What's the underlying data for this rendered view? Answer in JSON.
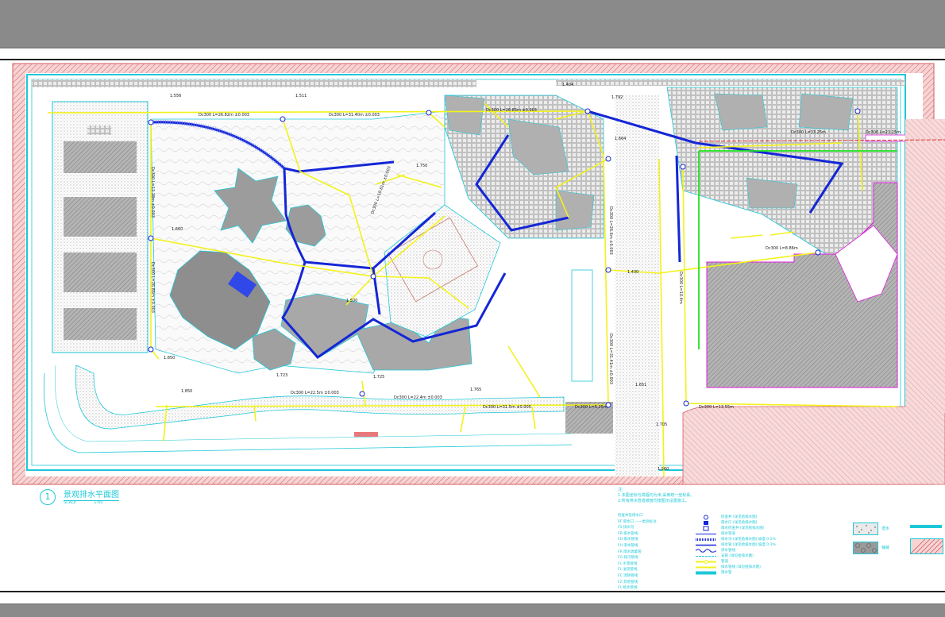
{
  "window": {
    "top_bar": "",
    "bottom_bar": ""
  },
  "plan": {
    "title_number": "1",
    "title": "景观排水平面图",
    "title_scale_left": "SCALE",
    "title_scale_right": "1:00",
    "elevations": [
      "1.556",
      "1.511",
      "1.404",
      "1.792",
      "1.750",
      "1.660",
      "1.500",
      "1.850",
      "1.725",
      "1.850",
      "1.723",
      "1.765",
      "1.430",
      "1.664",
      "1.705",
      "1.560",
      "1.651"
    ],
    "pipe_labels": [
      "Dc300 L=26.82m ±0.003",
      "Dc300 L=31.40m ±0.003",
      "Dc300 L=26.85m ±0.003",
      "Dc300 L=22.5m ±0.003",
      "Dc300 L=22.4m ±0.003",
      "Dc300 L=31.5m ±0.005",
      "Dc300 L=5.25m",
      "Dc300 L=33.25m",
      "Dc300 L=23.25m",
      "Dc300 L=8.86m",
      "Dc300 L=13.55m"
    ]
  },
  "notes": {
    "heading": "注:",
    "lines": [
      "1.本图坐标与高程均为米,采用统一坐标系。",
      "2.所有排水管道坡度均按图示设置施工。"
    ]
  },
  "legend": {
    "list": [
      "检查井及雨水口",
      "PF 雨水口 ——类别标注",
      "FS 排水沟",
      "FB 排水管线",
      "FD 雨水管线",
      "FH 渗水管线",
      "FR 雨水收集管",
      "FG 排污管线",
      "FL 水景管线",
      "FL 溢流管线",
      "FC 消防管线",
      "FZ 其他管线",
      "FL 给水管线"
    ],
    "symbols": [
      "检查井 (详见给排水图)",
      "雨水口 (详见给排水图)",
      "雨水检查井 (详见给排水图)",
      "排水管道",
      "排水沟 (详见给排水图)  坡度 0.5%",
      "排水管 (详见给排水图)  坡度 0.3%",
      "渗水管线",
      "盲管 (详见给排水图)",
      "管道",
      "排水管线 (详见给排水图)",
      "雨水管"
    ],
    "swatches": [
      "透水",
      "铺装"
    ]
  },
  "colors": {
    "cyan": "#1ec8d8",
    "blue": "#1426d6",
    "yellow": "#f2f21a",
    "green": "#1ee61e",
    "red_hatch": "#e8787c",
    "magenta": "#e01ee0",
    "gray_fill": "#a8a8a8"
  }
}
